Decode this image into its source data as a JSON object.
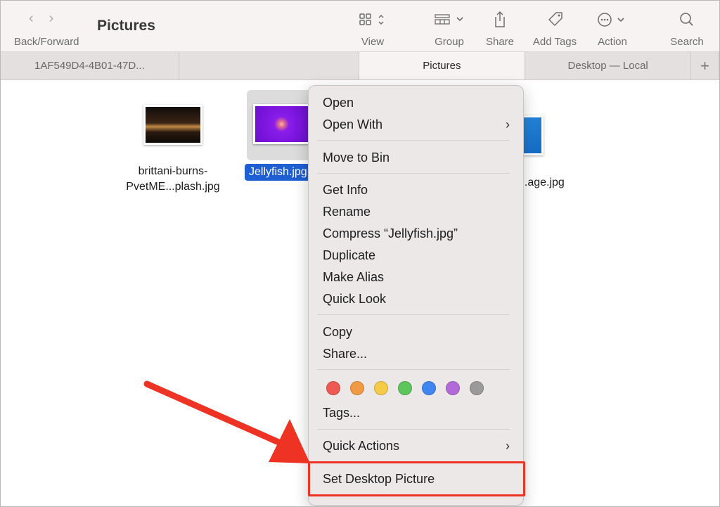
{
  "toolbar": {
    "back_forward_label": "Back/Forward",
    "title": "Pictures",
    "view_label": "View",
    "group_label": "Group",
    "share_label": "Share",
    "add_tags_label": "Add Tags",
    "action_label": "Action",
    "search_label": "Search"
  },
  "tabs": [
    {
      "label": "1AF549D4-4B01-47D..."
    },
    {
      "label": ""
    },
    {
      "label": "Pictures"
    },
    {
      "label": "Desktop — Local"
    }
  ],
  "new_tab_label": "+",
  "files": [
    {
      "line1": "brittani-burns-",
      "line2": "PvetME...plash.jpg"
    },
    {
      "line1": "Jellyfish.jpg",
      "line2": ""
    },
    {
      "line1": "...age.jpg",
      "line2": ""
    }
  ],
  "menu": {
    "open": "Open",
    "open_with": "Open With",
    "move_to_bin": "Move to Bin",
    "get_info": "Get Info",
    "rename": "Rename",
    "compress": "Compress “Jellyfish.jpg”",
    "duplicate": "Duplicate",
    "make_alias": "Make Alias",
    "quick_look": "Quick Look",
    "copy": "Copy",
    "share": "Share...",
    "tags": "Tags...",
    "quick_actions": "Quick Actions",
    "set_desktop_picture": "Set Desktop Picture",
    "chevron": "›"
  },
  "tag_colors": [
    "#ee5a52",
    "#f19a44",
    "#f5cb46",
    "#5cc55b",
    "#3f86f2",
    "#b36ad8",
    "#9a9a9a"
  ],
  "colors": {
    "selection": "#1e5fd4",
    "annotation": "#ee3224"
  },
  "icons": [
    "back-arrow-icon",
    "forward-arrow-icon",
    "view-grid-icon",
    "group-icon",
    "share-icon",
    "tag-icon",
    "action-ellipsis-icon",
    "search-icon"
  ]
}
